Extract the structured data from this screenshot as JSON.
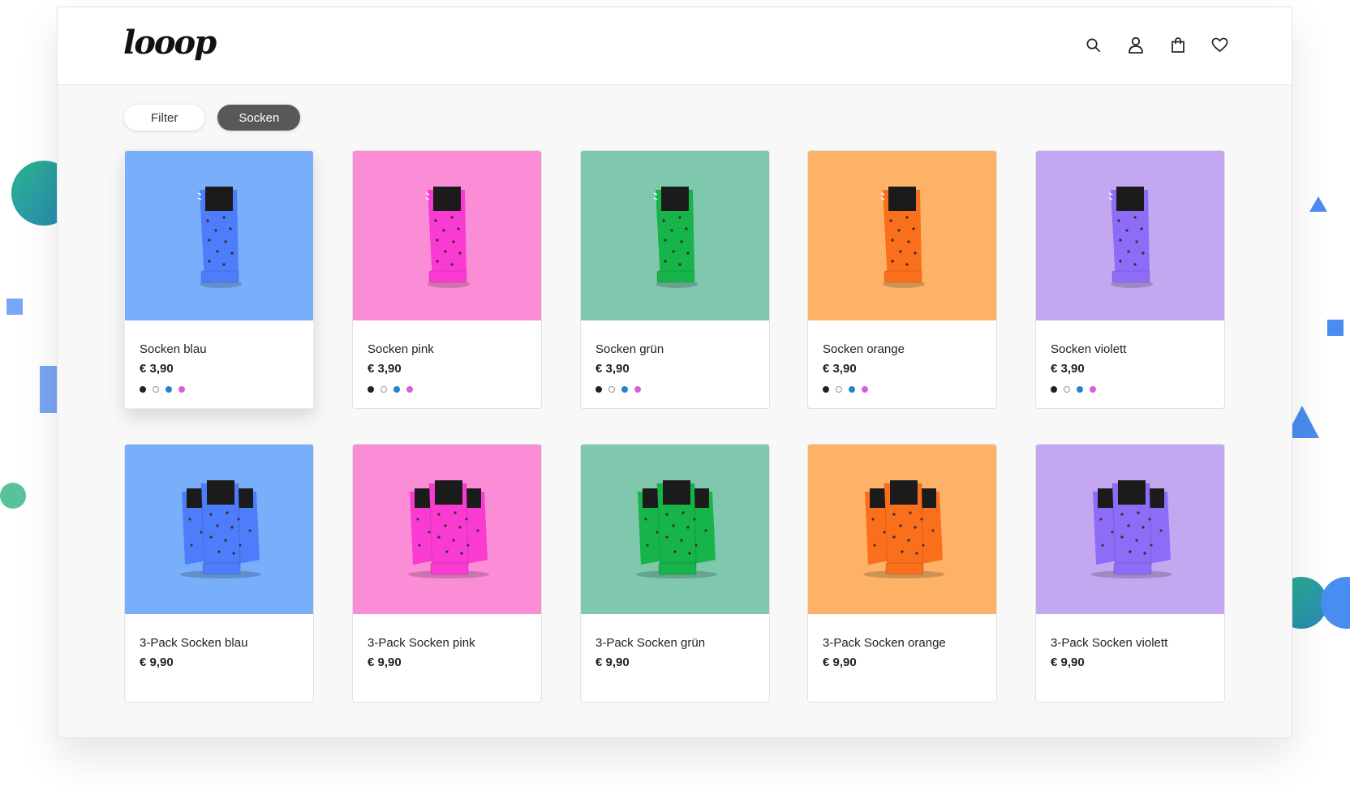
{
  "brand": {
    "logo_text": "looop"
  },
  "colors": {
    "blue": "#79aefb",
    "pink": "#fb8dd6",
    "green": "#7fc7ad",
    "orange": "#fdb268",
    "violet": "#c3a7f1",
    "sock_blue": "#4d7dfa",
    "sock_pink": "#fa3bd2",
    "sock_green": "#16b449",
    "sock_orange": "#fa6f1c",
    "sock_violet": "#8d6cf7"
  },
  "header": {
    "icons": [
      "search-icon",
      "user-icon",
      "shopping-bag-icon",
      "heart-icon"
    ]
  },
  "filters": {
    "filter_label": "Filter",
    "active_label": "Socken"
  },
  "swatch_colors": [
    "#222222",
    "#ffffff",
    "#1f86c8",
    "#d95ee0"
  ],
  "products": [
    {
      "name": "Socken blau",
      "price": "€ 3,90"
    },
    {
      "name": "Socken pink",
      "price": "€ 3,90"
    },
    {
      "name": "Socken grün",
      "price": "€ 3,90"
    },
    {
      "name": "Socken orange",
      "price": "€ 3,90"
    },
    {
      "name": "Socken violett",
      "price": "€ 3,90"
    },
    {
      "name": "3-Pack Socken blau",
      "price": "€ 9,90"
    },
    {
      "name": "3-Pack Socken pink",
      "price": "€ 9,90"
    },
    {
      "name": "3-Pack Socken grün",
      "price": "€ 9,90"
    },
    {
      "name": "3-Pack Socken orange",
      "price": "€ 9,90"
    },
    {
      "name": "3-Pack Socken violett",
      "price": "€ 9,90"
    }
  ]
}
